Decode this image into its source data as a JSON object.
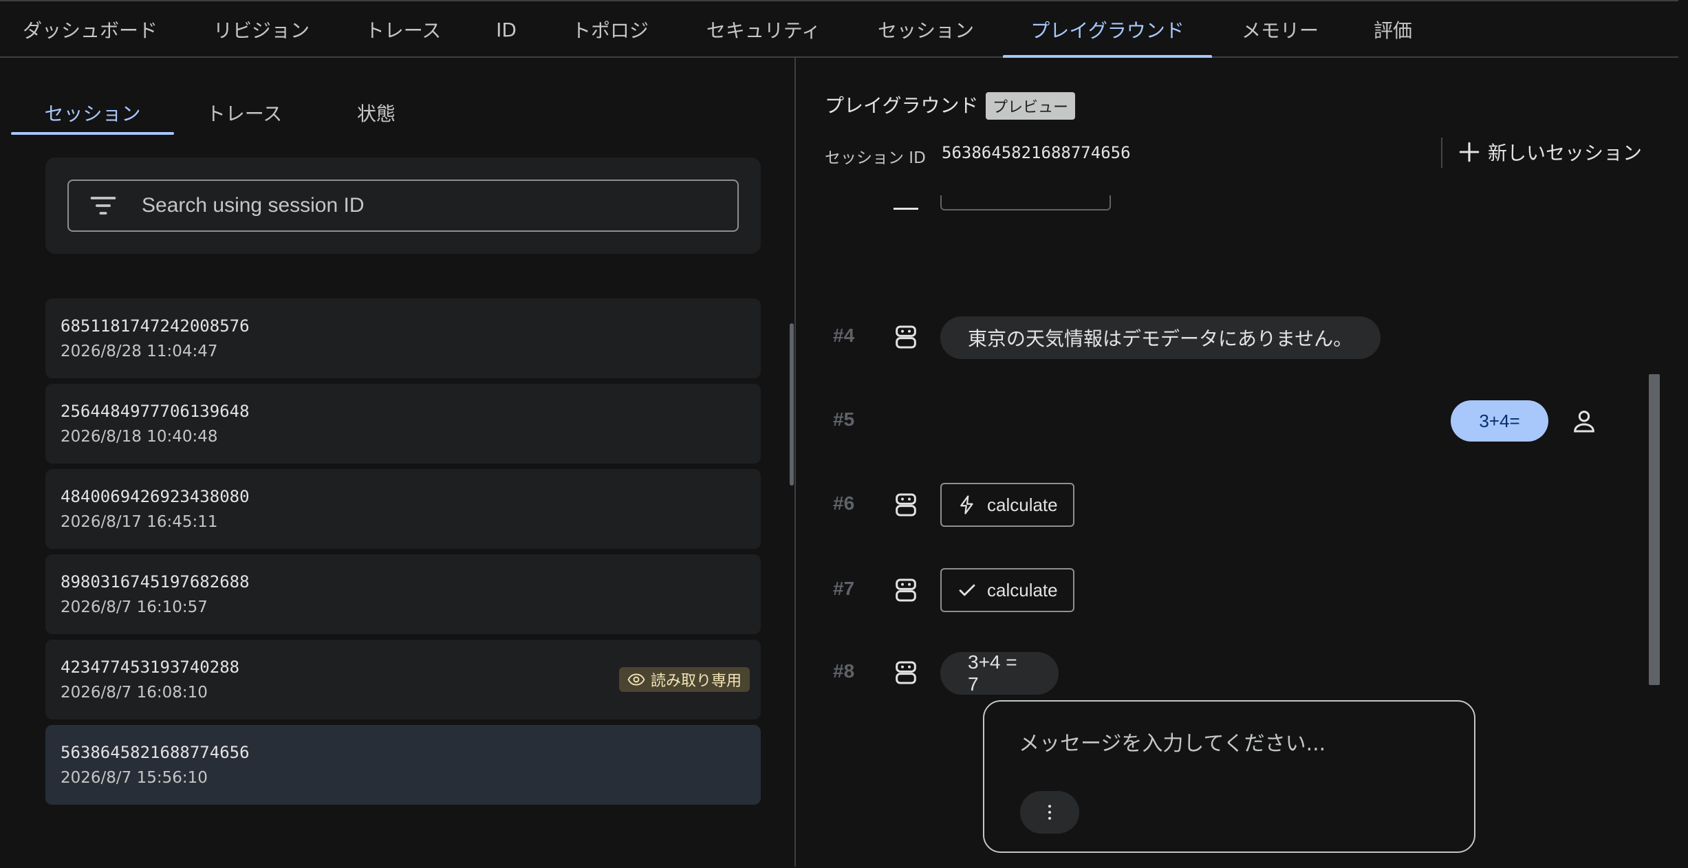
{
  "top_nav": {
    "tabs": [
      {
        "label": "ダッシュボード"
      },
      {
        "label": "リビジョン"
      },
      {
        "label": "トレース"
      },
      {
        "label": "ID"
      },
      {
        "label": "トポロジ"
      },
      {
        "label": "セキュリティ"
      },
      {
        "label": "セッション"
      },
      {
        "label": "プレイグラウンド"
      },
      {
        "label": "メモリー"
      },
      {
        "label": "評価"
      }
    ],
    "active": "プレイグラウンド"
  },
  "left_panel": {
    "tabs": [
      {
        "label": "セッション"
      },
      {
        "label": "トレース"
      },
      {
        "label": "状態"
      }
    ],
    "active_tab": "セッション",
    "search": {
      "placeholder": "Search using session ID",
      "value": ""
    },
    "sessions": [
      {
        "id": "6851181747242008576",
        "date": "2026/8/28 11:04:47"
      },
      {
        "id": "2564484977706139648",
        "date": "2026/8/18 10:40:48"
      },
      {
        "id": "4840069426923438080",
        "date": "2026/8/17 16:45:11"
      },
      {
        "id": "8980316745197682688",
        "date": "2026/8/7 16:10:57"
      },
      {
        "id": "423477453193740288",
        "date": "2026/8/7 16:08:10",
        "badge": "読み取り専用"
      },
      {
        "id": "5638645821688774656",
        "date": "2026/8/7 15:56:10",
        "selected": true
      }
    ]
  },
  "right_panel": {
    "title": "プレイグラウンド",
    "preview_badge": "プレビュー",
    "session_label": "セッション ID",
    "session_id": "5638645821688774656",
    "new_session_label": "新しいセッション",
    "messages": [
      {
        "num": "#4",
        "role": "bot",
        "text": "東京の天気情報はデモデータにありません。"
      },
      {
        "num": "#5",
        "role": "user",
        "text": "3+4="
      },
      {
        "num": "#6",
        "role": "bot",
        "tool": "function-call",
        "icon": "bolt-icon",
        "text": "calculate"
      },
      {
        "num": "#7",
        "role": "bot",
        "tool": "function-response",
        "icon": "check-icon",
        "text": "calculate"
      },
      {
        "num": "#8",
        "role": "bot",
        "text": "3+4 = 7"
      }
    ],
    "composer": {
      "placeholder": "メッセージを入力してください...",
      "value": ""
    }
  },
  "colors": {
    "background": "#131314",
    "accent": "#a8c7fa",
    "card": "#1e1f20",
    "selected_card": "#282e38",
    "readonly_badge": "#4a4431"
  }
}
